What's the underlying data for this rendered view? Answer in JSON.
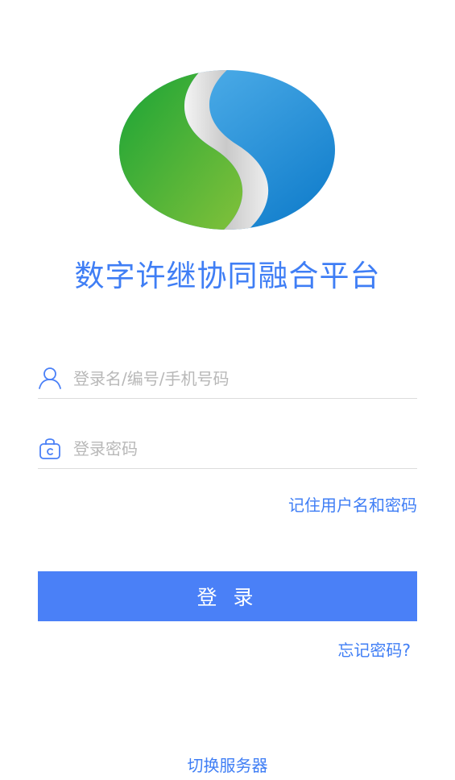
{
  "app": {
    "title": "数字许继协同融合平台",
    "accent_color": "#4a80f7"
  },
  "logo": {
    "icon": "s-logo-icon",
    "colors": {
      "left": "#3fae3c",
      "right": "#1b8fd8",
      "band": "#d8d8d8"
    }
  },
  "login_form": {
    "username": {
      "icon": "user-icon",
      "value": "",
      "placeholder": "登录名/编号/手机号码"
    },
    "password": {
      "icon": "lock-icon",
      "value": "",
      "placeholder": "登录密码"
    },
    "remember_label": "记住用户名和密码",
    "login_label": "登 录",
    "forgot_label": "忘记密码?"
  },
  "footer": {
    "switch_server_label": "切换服务器"
  }
}
